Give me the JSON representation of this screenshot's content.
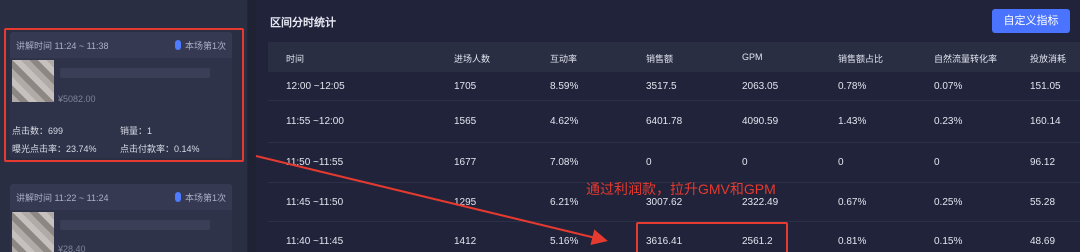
{
  "left_panel": {
    "cards": [
      {
        "time_label": "讲解时间 11:24 ~ 11:38",
        "badge": "本场第1次",
        "price": "¥5082.00",
        "clicks": "点击数：699",
        "sales": "销量：1",
        "exposure_ctr": "曝光点击率：23.74%",
        "click_pay_rate": "点击付款率：0.14%"
      },
      {
        "time_label": "讲解时间 11:22 ~ 11:24",
        "badge": "本场第1次",
        "price": "¥28.40"
      }
    ]
  },
  "main": {
    "title": "区间分时统计",
    "custom_button": "自定义指标",
    "columns": [
      "时间",
      "进场人数",
      "互动率",
      "销售额",
      "GPM",
      "销售额占比",
      "自然流量转化率",
      "投放消耗"
    ],
    "rows": [
      [
        "12:00 ~12:05",
        "1705",
        "8.59%",
        "3517.5",
        "2063.05",
        "0.78%",
        "0.07%",
        "151.05"
      ],
      [
        "11:55 ~12:00",
        "1565",
        "4.62%",
        "6401.78",
        "4090.59",
        "1.43%",
        "0.23%",
        "160.14"
      ],
      [
        "11:50 ~11:55",
        "1677",
        "7.08%",
        "0",
        "0",
        "0",
        "0",
        "96.12"
      ],
      [
        "11:45 ~11:50",
        "1295",
        "6.21%",
        "3007.62",
        "2322.49",
        "0.67%",
        "0.25%",
        "55.28"
      ],
      [
        "11:40 ~11:45",
        "1412",
        "5.16%",
        "3616.41",
        "2561.2",
        "0.81%",
        "0.15%",
        "48.69"
      ]
    ],
    "annotation": "通过利润款，拉升GMV和GPM"
  },
  "colors": {
    "accent": "#4a74ff",
    "highlight_red": "#e53a2f",
    "background": "#20233a"
  }
}
